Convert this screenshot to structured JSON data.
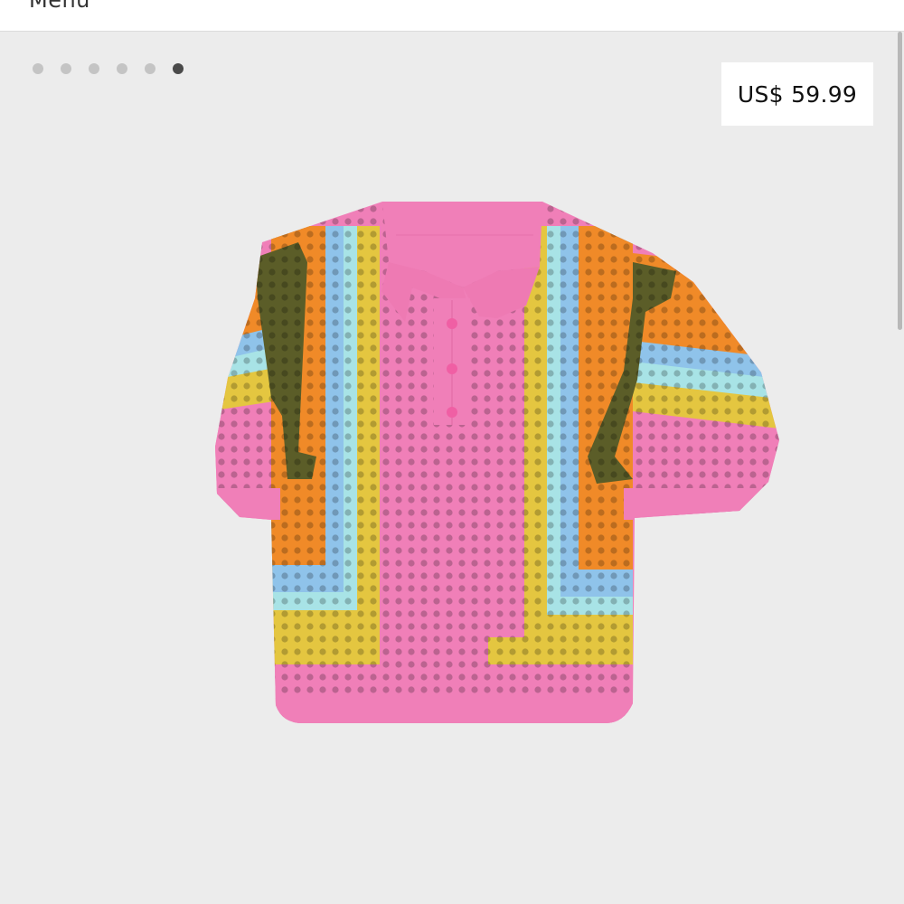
{
  "header": {
    "menu_label": "Menu"
  },
  "gallery": {
    "image_count": 6,
    "active_index": 5,
    "price": "US$ 59.99",
    "product_icon": "crochet-polo-shirt"
  },
  "colors": {
    "pink": "#f07fb8",
    "orange": "#f08a28",
    "olive": "#5b5d28",
    "sky": "#8fc3ea",
    "aqua": "#a8e3e6",
    "yellow": "#e4c640",
    "background": "#ececec"
  }
}
